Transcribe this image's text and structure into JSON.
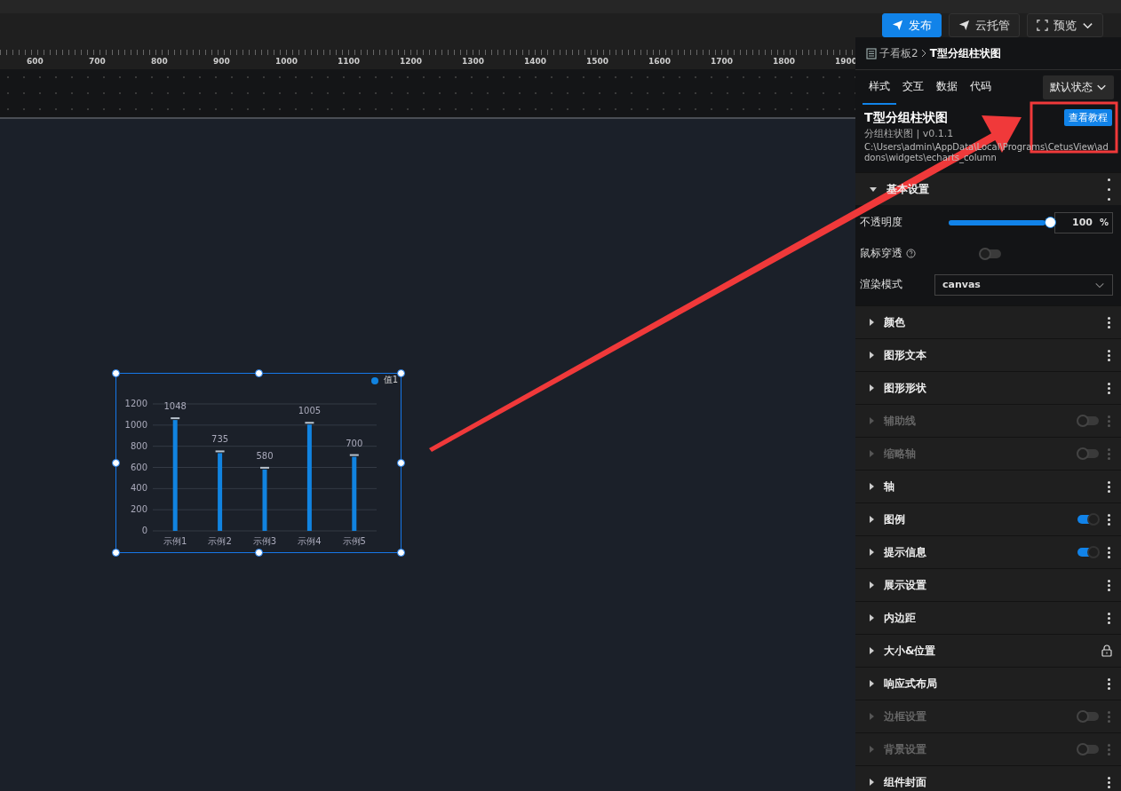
{
  "toolbar": {
    "buttons": [
      {
        "label": "发布",
        "kind": "primary"
      },
      {
        "label": "云托管",
        "kind": "plain"
      },
      {
        "label": "预览",
        "kind": "dropdown"
      }
    ]
  },
  "ruler": {
    "labels": [
      "600",
      "700",
      "800",
      "900",
      "1000",
      "1100",
      "1200",
      "1300",
      "1400",
      "1500",
      "1600",
      "1700",
      "1800",
      "1900"
    ]
  },
  "widget": {
    "chart_data": {
      "type": "bar",
      "grid": true,
      "categories": [
        "示例1",
        "示例2",
        "示例3",
        "示例4",
        "示例5"
      ],
      "series": [
        {
          "name": "值1",
          "color": "#1183e0",
          "values": [
            1048,
            735,
            580,
            1005,
            700
          ]
        }
      ],
      "ylim": [
        0,
        1200
      ],
      "yticks": [
        0,
        200,
        400,
        600,
        800,
        1000,
        1200
      ],
      "data_labels": true
    }
  },
  "panel": {
    "breadcrumb": {
      "parent": "子看板2",
      "current": "T型分组柱状图"
    },
    "tabs": [
      {
        "label": "样式",
        "selected": true
      },
      {
        "label": "交互",
        "selected": false
      },
      {
        "label": "数据",
        "selected": false
      },
      {
        "label": "代码",
        "selected": false
      }
    ],
    "state_select": "默认状态",
    "component": {
      "title": "T型分组柱状图",
      "subtitle": "分组柱状图 | v0.1.1",
      "path": "C:\\Users\\admin\\AppData\\Local\\Programs\\CetusView\\addons\\widgets\\echarts_column",
      "tutorial_button": "查看教程"
    },
    "base_section": {
      "title": "基本设置",
      "expanded": true,
      "opacity": {
        "label": "不透明度",
        "level": 1,
        "value": "100",
        "unit": "%"
      },
      "pass_through": {
        "label": "鼠标穿透",
        "on": false
      },
      "render_mode": {
        "label": "渲染模式",
        "value": "canvas"
      }
    },
    "sections": [
      {
        "title": "颜色",
        "kind": "menu",
        "disabled": false
      },
      {
        "title": "图形文本",
        "kind": "menu",
        "disabled": false
      },
      {
        "title": "图形形状",
        "kind": "menu",
        "disabled": false
      },
      {
        "title": "辅助线",
        "kind": "toggle",
        "on": false,
        "disabled": true
      },
      {
        "title": "缩略轴",
        "kind": "toggle",
        "on": false,
        "disabled": true
      },
      {
        "title": "轴",
        "kind": "menu",
        "disabled": false
      },
      {
        "title": "图例",
        "kind": "toggle",
        "on": true,
        "disabled": false
      },
      {
        "title": "提示信息",
        "kind": "toggle",
        "on": true,
        "disabled": false
      },
      {
        "title": "展示设置",
        "kind": "menu",
        "disabled": false
      },
      {
        "title": "内边距",
        "kind": "menu",
        "disabled": false
      },
      {
        "title": "大小&位置",
        "kind": "lock",
        "disabled": false
      },
      {
        "title": "响应式布局",
        "kind": "menu",
        "disabled": false
      },
      {
        "title": "边框设置",
        "kind": "toggle",
        "on": false,
        "disabled": true
      },
      {
        "title": "背景设置",
        "kind": "toggle",
        "on": false,
        "disabled": true
      },
      {
        "title": "组件封面",
        "kind": "menu",
        "disabled": false
      }
    ]
  }
}
